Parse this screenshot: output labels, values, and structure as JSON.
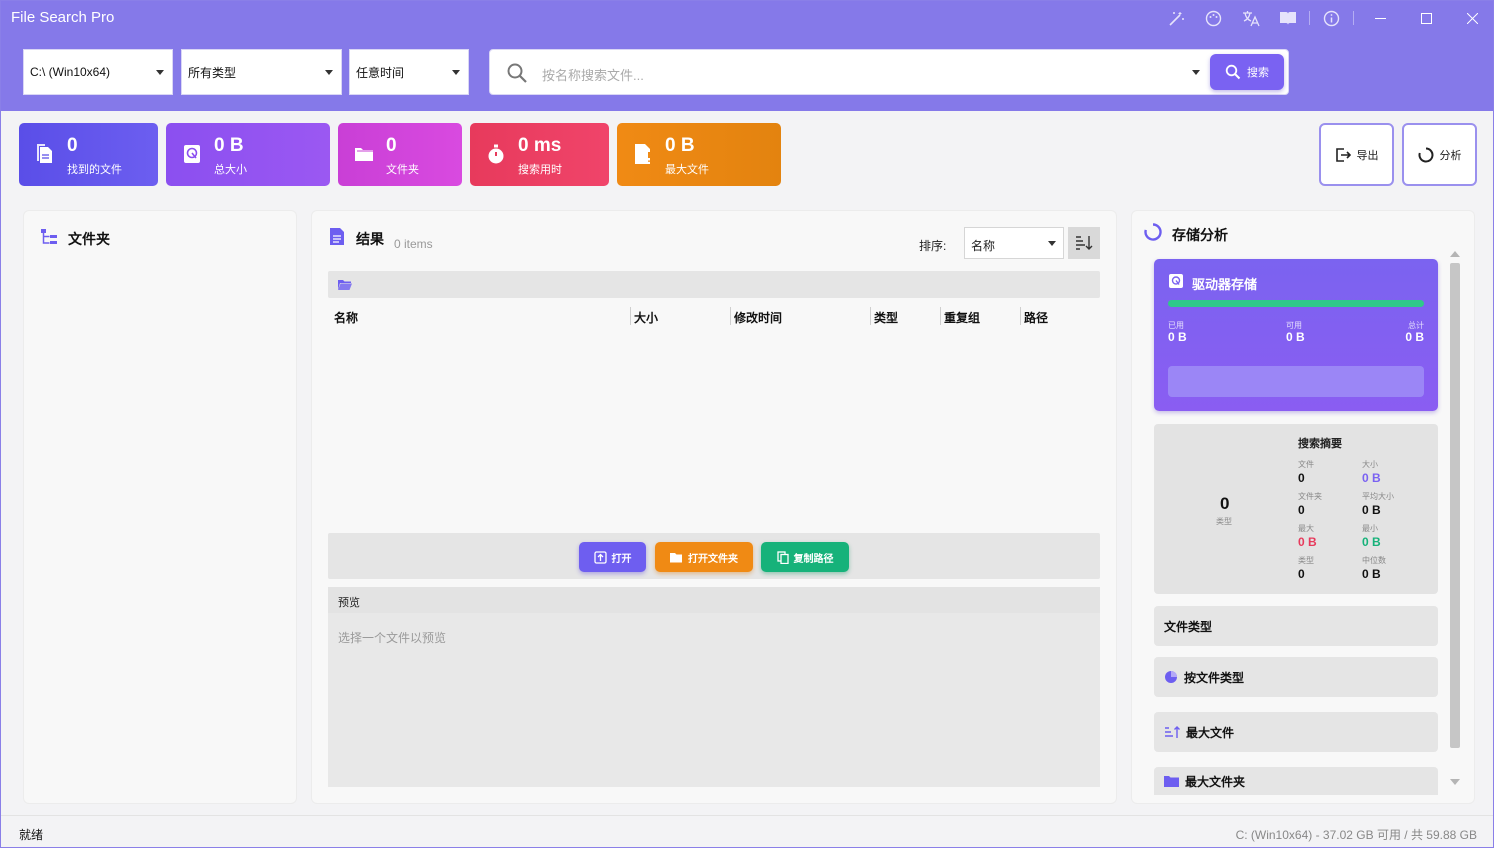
{
  "app": {
    "title": "File Search Pro"
  },
  "filters": {
    "drive": "C:\\ (Win10x64)",
    "type": "所有类型",
    "time": "任意时间"
  },
  "search": {
    "placeholder": "按名称搜索文件...",
    "button": "搜索"
  },
  "stats": [
    {
      "value": "0",
      "label": "找到的文件"
    },
    {
      "value": "0 B",
      "label": "总大小"
    },
    {
      "value": "0",
      "label": "文件夹"
    },
    {
      "value": "0 ms",
      "label": "搜索用时"
    },
    {
      "value": "0 B",
      "label": "最大文件"
    }
  ],
  "toolbar": {
    "export": "导出",
    "analyze": "分析"
  },
  "folders": {
    "title": "文件夹"
  },
  "results": {
    "title": "结果",
    "count": "0 items",
    "sort_label": "排序:",
    "sort_value": "名称",
    "columns": [
      "名称",
      "大小",
      "修改时间",
      "类型",
      "重复组",
      "路径"
    ],
    "actions": {
      "open": "打开",
      "open_folder": "打开文件夹",
      "copy_path": "复制路径"
    },
    "preview_title": "预览",
    "preview_placeholder": "选择一个文件以预览"
  },
  "storage": {
    "title": "存储分析",
    "drive_title": "驱动器存储",
    "used_label": "已用",
    "used": "0 B",
    "free_label": "可用",
    "free": "0 B",
    "total_label": "总计",
    "total": "0 B",
    "summary": {
      "title": "搜索摘要",
      "types_count": "0",
      "types_label": "类型",
      "files_label": "文件",
      "files": "0",
      "size_label": "大小",
      "size": "0 B",
      "folders_label": "文件夹",
      "folders": "0",
      "avg_label": "平均大小",
      "avg": "0 B",
      "max_label": "最大",
      "max": "0 B",
      "min_label": "最小",
      "min": "0 B",
      "type_label": "类型",
      "type": "0",
      "median_label": "中位数",
      "median": "0 B"
    },
    "sections": [
      "文件类型",
      "按文件类型",
      "最大文件",
      "最大文件夹"
    ]
  },
  "status": {
    "left": "就绪",
    "right": "C: (Win10x64) - 37.02 GB 可用 / 共 59.88 GB"
  },
  "colors": {
    "accent": "#8579e9",
    "green": "#2fc98a",
    "red": "#e73a5c",
    "orange": "#f08a14"
  }
}
